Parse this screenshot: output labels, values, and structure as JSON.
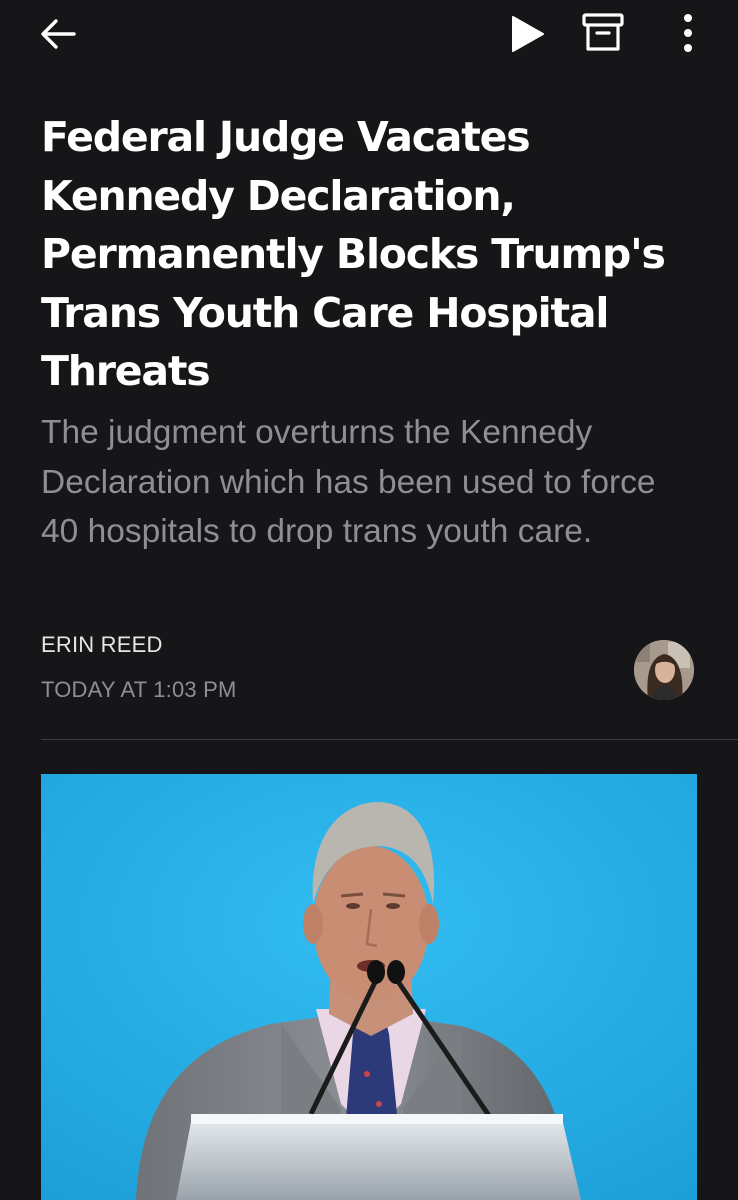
{
  "toolbar": {
    "back_icon": "arrow-left-icon",
    "play_icon": "play-icon",
    "archive_icon": "archive-box-icon",
    "more_icon": "vertical-dots-icon"
  },
  "article": {
    "title": "Federal Judge Vacates Kennedy Declaration, Permanently Blocks Trump's Trans Youth Care Hospital Threats",
    "subtitle": "The judgment overturns the Kennedy Declaration which has been used to force 40 hospitals to drop trans youth care.",
    "author": "ERIN REED",
    "timestamp": "TODAY AT 1:03 PM"
  },
  "colors": {
    "background": "#161618",
    "title": "#ffffff",
    "subtitle": "#8e8e93",
    "hero_background": "#2ab0e8"
  }
}
